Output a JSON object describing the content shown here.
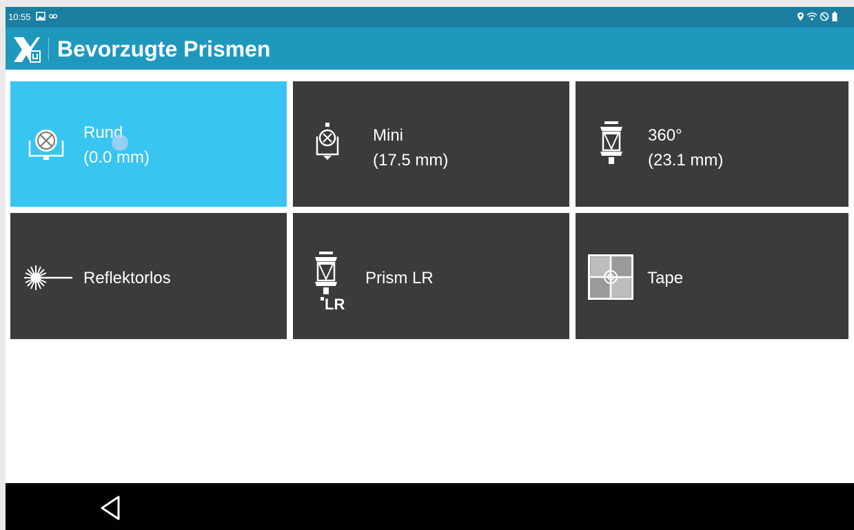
{
  "status_bar": {
    "time": "10:55",
    "left_icons": [
      "image-icon",
      "voicemail-icon"
    ],
    "right_icons": [
      "location-icon",
      "wifi-icon",
      "do-not-disturb-icon",
      "battery-icon"
    ]
  },
  "title_bar": {
    "title": "Bevorzugte Prismen",
    "logo_icon": "app-logo-icon"
  },
  "colors": {
    "status_bar": "#1b7fa1",
    "title_bar": "#2098bd",
    "tile": "#3b3b3b",
    "tile_selected": "#39c5f2",
    "nav_bar": "#000000"
  },
  "prisms": [
    {
      "name": "Rund",
      "constant": "(0.0 mm)",
      "icon": "round-prism-icon",
      "selected": true
    },
    {
      "name": "Mini",
      "constant": "(17.5 mm)",
      "icon": "mini-prism-icon",
      "selected": false
    },
    {
      "name": "360°",
      "constant": "(23.1 mm)",
      "icon": "360-prism-icon",
      "selected": false
    },
    {
      "name": "Reflektorlos",
      "constant": "",
      "icon": "reflectorless-icon",
      "selected": false
    },
    {
      "name": "Prism LR",
      "constant": "",
      "icon": "prism-lr-icon",
      "icon_text": "LR",
      "selected": false
    },
    {
      "name": "Tape",
      "constant": "",
      "icon": "tape-target-icon",
      "selected": false
    }
  ],
  "nav_bar": {
    "back_icon": "back-triangle-icon"
  }
}
